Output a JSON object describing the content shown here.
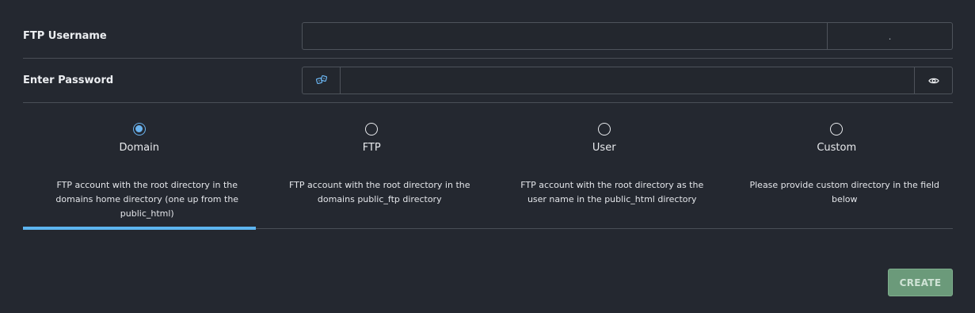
{
  "form": {
    "username": {
      "label": "FTP Username",
      "value": "",
      "placeholder": "",
      "suffix": "."
    },
    "password": {
      "label": "Enter Password",
      "value": "",
      "placeholder": "",
      "generate_icon": "dice-icon",
      "toggle_icon": "eye-icon"
    }
  },
  "directory_options": [
    {
      "label": "Domain",
      "description": "FTP account with the root directory in the domains home directory (one up from the public_html)",
      "selected": true
    },
    {
      "label": "FTP",
      "description": "FTP account with the root directory in the domains public_ftp directory",
      "selected": false
    },
    {
      "label": "User",
      "description": "FTP account with the root directory as the user name in the public_html directory",
      "selected": false
    },
    {
      "label": "Custom",
      "description": "Please provide custom directory in the field below",
      "selected": false
    }
  ],
  "actions": {
    "create_label": "CREATE",
    "create_enabled": false
  },
  "colors": {
    "background": "#242830",
    "accent": "#5db4ef",
    "create_button": "#6b9a7a"
  }
}
